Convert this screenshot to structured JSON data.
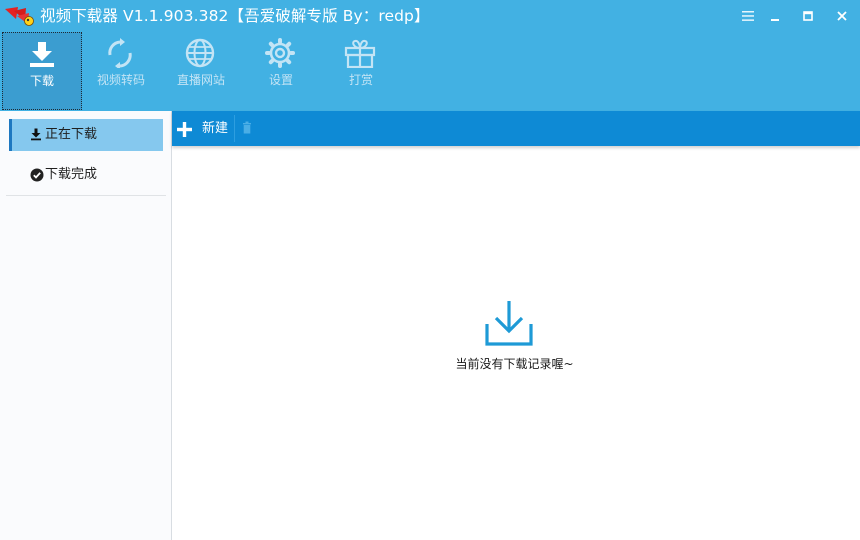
{
  "window": {
    "title": "视频下载器 V1.1.903.382【吾爱破解专版 By：redp】",
    "controls": [
      "menu-icon",
      "minimize-icon",
      "maximize-icon",
      "close-icon"
    ]
  },
  "toolbar": {
    "items": [
      {
        "label": "下载",
        "icon": "download-icon",
        "active": true
      },
      {
        "label": "视频转码",
        "icon": "convert-icon",
        "active": false
      },
      {
        "label": "直播网站",
        "icon": "globe-icon",
        "active": false
      },
      {
        "label": "设置",
        "icon": "gear-icon",
        "active": false
      },
      {
        "label": "打赏",
        "icon": "gift-icon",
        "active": false
      }
    ]
  },
  "sidebar": {
    "items": [
      {
        "label": "正在下载",
        "icon": "download-small-icon",
        "active": true
      },
      {
        "label": "下载完成",
        "icon": "check-circle-icon",
        "active": false
      }
    ]
  },
  "main": {
    "new_label": "新建",
    "empty_message": "当前没有下载记录喔~"
  },
  "colors": {
    "titlebar": "#42b1e3",
    "main_toolbar": "#0e8ad5",
    "active_toolbar": "#3b9dd0",
    "sidebar_active": "#85c8ee",
    "empty_icon": "#1e9ad6"
  }
}
